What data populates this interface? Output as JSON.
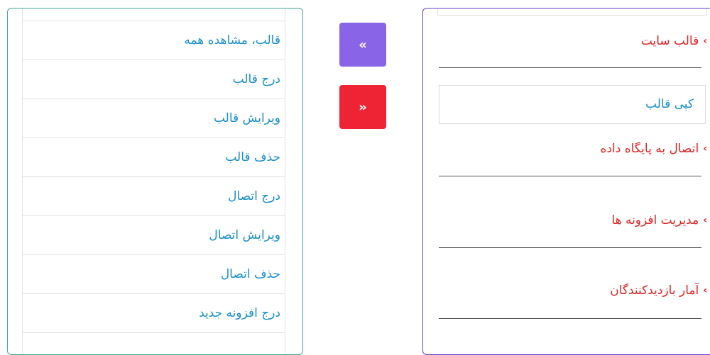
{
  "left_menu": {
    "items": [
      {
        "label": "قالب، مشاهده همه"
      },
      {
        "label": "درج قالب"
      },
      {
        "label": "ویرایش قالب"
      },
      {
        "label": "حذف قالب"
      },
      {
        "label": "درج اتصال"
      },
      {
        "label": "ویرایش اتصال"
      },
      {
        "label": "حذف اتصال"
      },
      {
        "label": "درج افزونه جدید"
      }
    ]
  },
  "buttons": {
    "collapse_all": {
      "label": "«",
      "color": "#8a64e6"
    },
    "expand_all": {
      "label": "»",
      "color": "#ee2435"
    }
  },
  "right_menu": {
    "chevron": "›",
    "items": [
      {
        "label": "قالب سایت"
      },
      {
        "label": "اتصال به پایگاه داده"
      },
      {
        "label": "مدیریت افزونه ها"
      },
      {
        "label": "آمار بازدیدکنندگان"
      }
    ],
    "sub_item": {
      "label": "کپی قالب"
    }
  },
  "colors": {
    "link_blue": "#1a8fc9",
    "accent_red": "#e02424",
    "left_border": "#3fa89a",
    "right_border": "#6a3fc7"
  }
}
